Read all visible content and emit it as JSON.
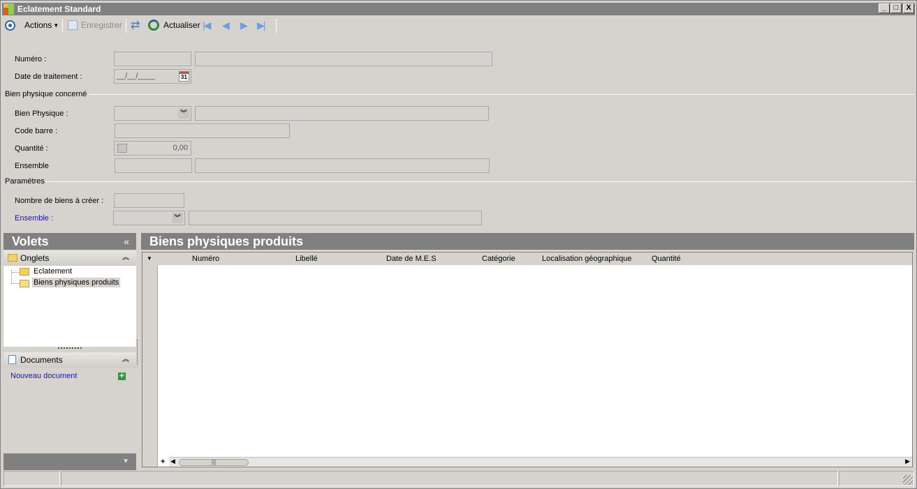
{
  "window": {
    "title": "Eclatement Standard",
    "minimize": "_",
    "maximize": "□",
    "close": "X"
  },
  "toolbar": {
    "actions_label": "Actions",
    "save_label": "Enregistrer",
    "refresh_label": "Actualiser"
  },
  "form": {
    "numero_label": "Numéro :",
    "date_label": "Date de traitement :",
    "date_placeholder": "__/__/____",
    "calendar_day": "31",
    "section_bien": "Bien physique concerné",
    "bien_physique_label": "Bien Physique :",
    "code_barre_label": "Code barre :",
    "quantite_label": "Quantité :",
    "quantite_value": "0,00",
    "ensemble_label": "Ensemble",
    "section_parametres": "Paramétres",
    "nombre_label": "Nombre de biens à créer :",
    "ensemble2_label": "Ensemble :"
  },
  "left_pane": {
    "title": "Volets",
    "collapse": "«",
    "group_onglets": "Onglets",
    "tree": [
      "Eclatement",
      "Biens physiques produits"
    ],
    "group_documents": "Documents",
    "new_document": "Nouveau document",
    "footer_arrow": "▼"
  },
  "main": {
    "title": "Biens physiques produits",
    "columns": [
      "Numéro",
      "Libellé",
      "Date de M.E.S",
      "Catégorie",
      "Localisation géographique",
      "Quantité"
    ],
    "add_row": "+"
  },
  "colors": {
    "header_bg": "#808080",
    "window_bg": "#d6d3ce",
    "link": "#1a1ab4"
  }
}
